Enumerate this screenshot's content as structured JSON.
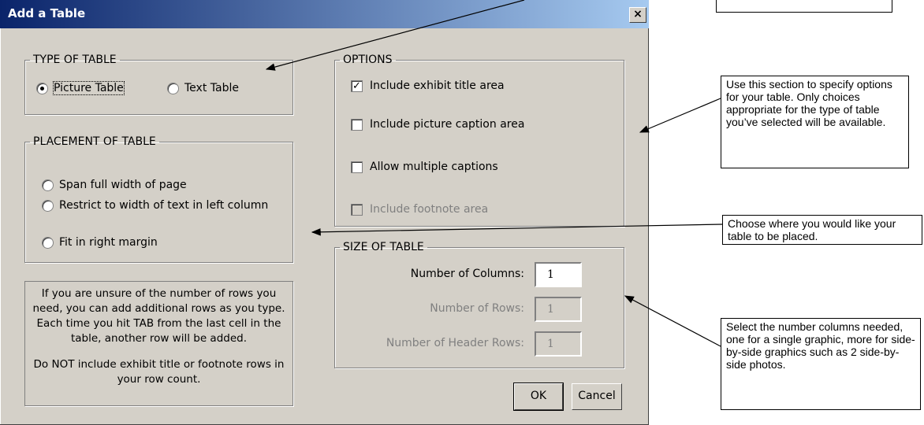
{
  "dialog": {
    "title": "Add a Table",
    "close_label": "×",
    "type_group": {
      "legend": "TYPE OF TABLE",
      "options": [
        "Picture Table",
        "Text Table"
      ],
      "selected": "Picture Table"
    },
    "placement_group": {
      "legend": "PLACEMENT OF TABLE",
      "options": [
        "Span full width of page",
        "Restrict to width of text in left column",
        "Fit in right margin"
      ]
    },
    "info_text": {
      "line1": "If you are unsure of the number of rows you need, you can add additional rows as you type. Each time you hit TAB from the last cell in the table, another row will be added.",
      "line2": "Do NOT include exhibit title or footnote rows in your row count."
    },
    "options_group": {
      "legend": "OPTIONS",
      "items": [
        {
          "label": "Include exhibit title area",
          "checked": true,
          "enabled": true
        },
        {
          "label": "Include picture caption area",
          "checked": false,
          "enabled": true
        },
        {
          "label": "Allow multiple captions",
          "checked": false,
          "enabled": true
        },
        {
          "label": "Include footnote area",
          "checked": false,
          "enabled": false
        }
      ]
    },
    "size_group": {
      "legend": "SIZE OF TABLE",
      "fields": [
        {
          "label": "Number of Columns:",
          "value": "1",
          "enabled": true
        },
        {
          "label": "Number of Rows:",
          "value": "1",
          "enabled": false
        },
        {
          "label": "Number of Header Rows:",
          "value": "1",
          "enabled": false
        }
      ]
    },
    "ok_label": "OK",
    "cancel_label": "Cancel"
  },
  "callouts": {
    "options": "Use this section to specify options for your table. Only choices appropriate for the type of table you’ve selected will be available.",
    "placement": "Choose where you would like your table to be placed.",
    "size": "Select the number columns needed, one for a single graphic, more for side-by-side graphics such as 2 side-by-side photos."
  }
}
